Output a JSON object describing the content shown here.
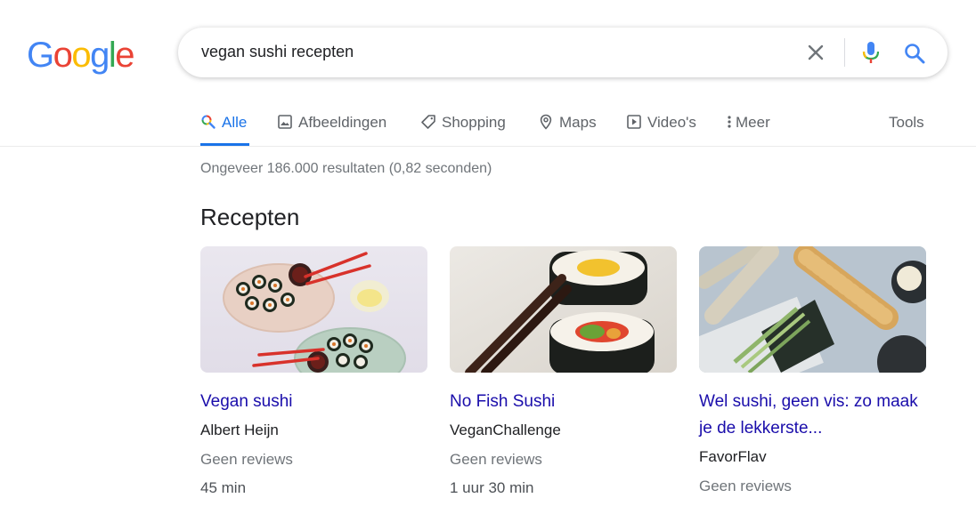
{
  "logo": {
    "letters": [
      "G",
      "o",
      "o",
      "g",
      "l",
      "e"
    ],
    "colors": [
      "#4285F4",
      "#EA4335",
      "#FBBC05",
      "#4285F4",
      "#34A853",
      "#EA4335"
    ]
  },
  "search": {
    "query": "vegan sushi recepten"
  },
  "tabs": [
    {
      "label": "Alle",
      "icon": "search-multicolor-icon",
      "active": true
    },
    {
      "label": "Afbeeldingen",
      "icon": "image-icon"
    },
    {
      "label": "Shopping",
      "icon": "tag-icon"
    },
    {
      "label": "Maps",
      "icon": "map-pin-icon"
    },
    {
      "label": "Video's",
      "icon": "play-icon"
    },
    {
      "label": "Meer",
      "icon": "more-vert-icon"
    },
    {
      "label": "Tools"
    }
  ],
  "results_stats": "Ongeveer 186.000 resultaten (0,82 seconden)",
  "recipes": {
    "heading": "Recepten",
    "cards": [
      {
        "title": "Vegan sushi",
        "source": "Albert Heijn",
        "reviews": "Geen reviews",
        "time": "45 min"
      },
      {
        "title": "No Fish Sushi",
        "source": "VeganChallenge",
        "reviews": "Geen reviews",
        "time": "1 uur 30 min"
      },
      {
        "title": "Wel sushi, geen vis: zo maak je de lekkerste...",
        "source": "FavorFlav",
        "reviews": "Geen reviews"
      }
    ]
  },
  "colors": {
    "accent": "#1a73e8",
    "link": "#1a0dab",
    "muted": "#70757a"
  }
}
